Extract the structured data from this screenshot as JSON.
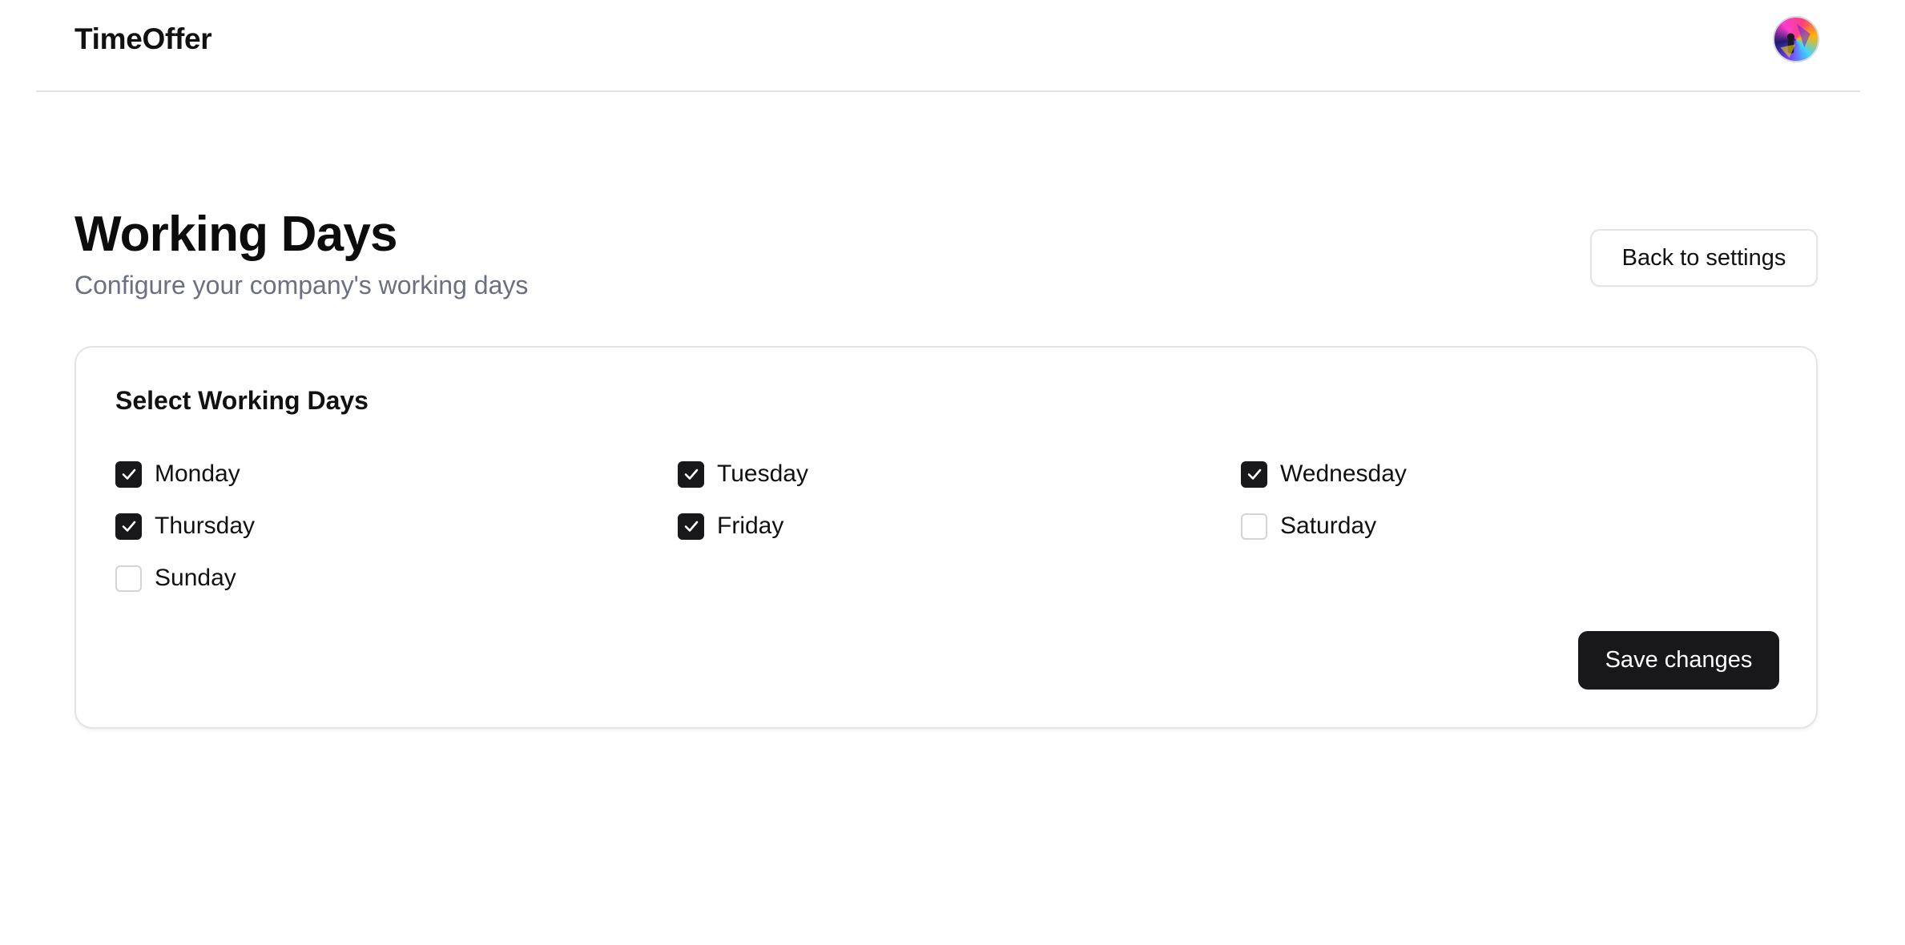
{
  "header": {
    "brand": "TimeOffer",
    "avatar_icon": "user-avatar"
  },
  "page": {
    "title": "Working Days",
    "subtitle": "Configure your company's working days",
    "back_label": "Back to settings"
  },
  "card": {
    "title": "Select Working Days",
    "days": [
      {
        "label": "Monday",
        "checked": true
      },
      {
        "label": "Tuesday",
        "checked": true
      },
      {
        "label": "Wednesday",
        "checked": true
      },
      {
        "label": "Thursday",
        "checked": true
      },
      {
        "label": "Friday",
        "checked": true
      },
      {
        "label": "Saturday",
        "checked": false
      },
      {
        "label": "Sunday",
        "checked": false
      }
    ],
    "save_label": "Save changes"
  },
  "colors": {
    "primary": "#18181b",
    "muted_text": "#6b6f80",
    "border": "#e4e4e7"
  }
}
